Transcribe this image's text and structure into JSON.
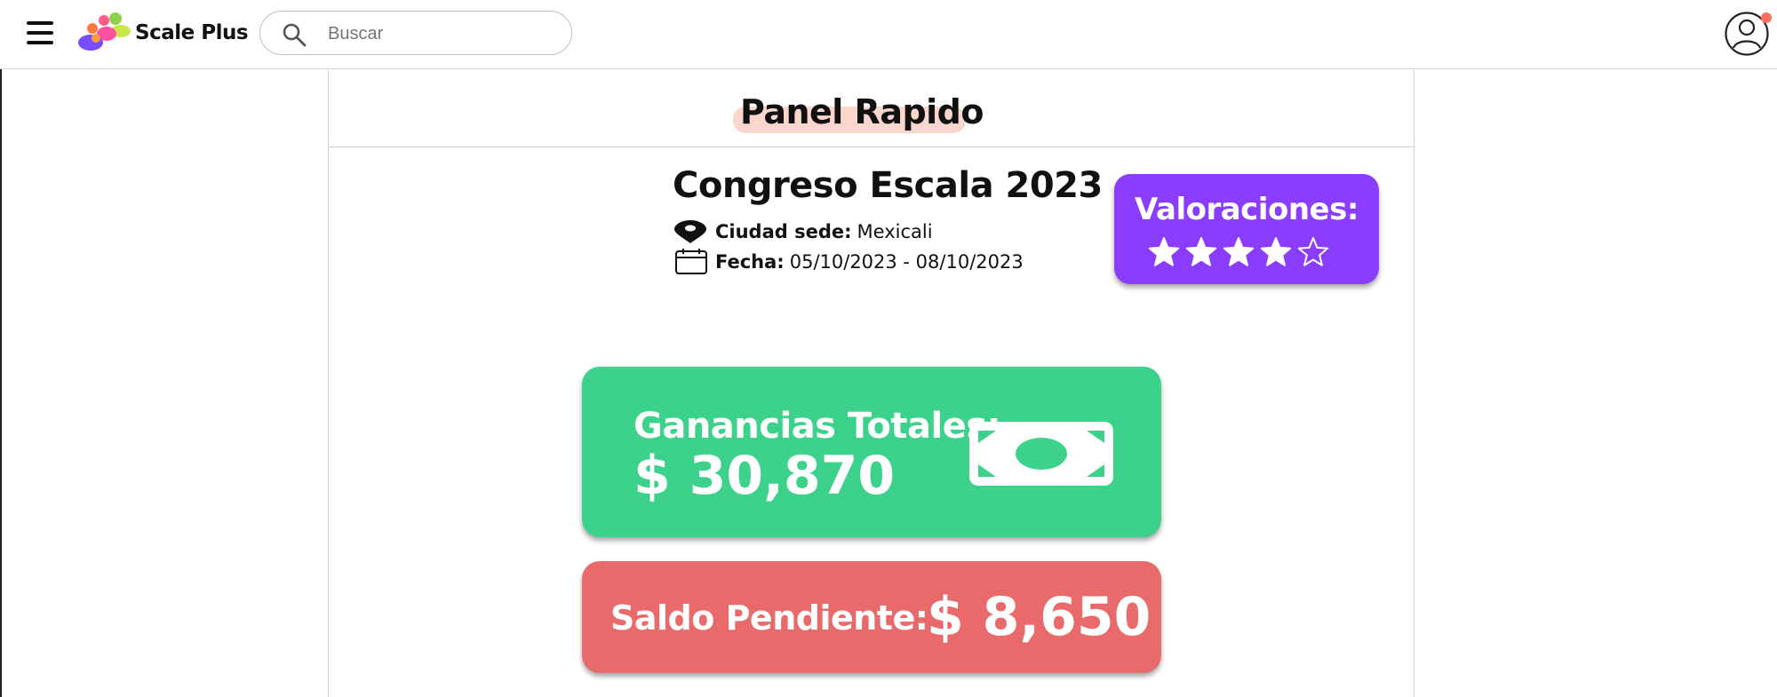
{
  "header": {
    "brand_name": "Scale Plus",
    "search_placeholder": "Buscar"
  },
  "panel": {
    "title": "Panel Rapido"
  },
  "event": {
    "title": "Congreso Escala 2023",
    "city_label": "Ciudad sede:",
    "city_value": "Mexicali",
    "date_label": "Fecha:",
    "date_value": "05/10/2023 - 08/10/2023"
  },
  "rating": {
    "title": "Valoraciones:",
    "value": 4,
    "max": 5
  },
  "earnings": {
    "label": "Ganancias Totales:",
    "value": "$ 30,870"
  },
  "balance": {
    "label": "Saldo Pendiente:",
    "value": "$ 8,650"
  },
  "colors": {
    "rating_card": "#8a3dff",
    "earnings_card": "#3dd28b",
    "balance_card": "#e96a6a",
    "title_highlight": "#fbd6cd",
    "notification_dot": "#ff6f5e"
  },
  "icons": {
    "menu": "hamburger-menu-icon",
    "search": "search-icon",
    "avatar": "user-avatar-icon",
    "location": "location-pin-icon",
    "calendar": "calendar-icon",
    "money": "banknote-icon",
    "star": "star-icon"
  }
}
